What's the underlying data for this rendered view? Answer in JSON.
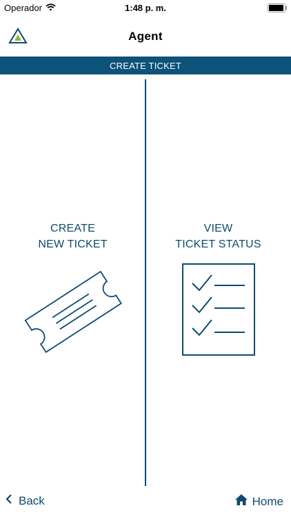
{
  "status_bar": {
    "carrier": "Operador",
    "time": "1:48 p. m.",
    "battery_level": 0.95,
    "icons": [
      "wifi-icon",
      "battery-icon"
    ]
  },
  "nav": {
    "title": "Agent",
    "logo_icon": "triangle-logo-icon"
  },
  "banner": {
    "text": "CREATE TICKET"
  },
  "options": {
    "create": {
      "line1": "CREATE",
      "line2": "NEW TICKET",
      "icon": "ticket-icon"
    },
    "view": {
      "line1": "VIEW",
      "line2": "TICKET STATUS",
      "icon": "checklist-icon"
    }
  },
  "bottom_bar": {
    "back_label": "Back",
    "home_label": "Home",
    "icons": [
      "chevron-left-icon",
      "home-icon"
    ]
  },
  "colors": {
    "primary": "#0d4a6e",
    "banner_bg": "#0d5278",
    "logo_accent": "#8cb83c"
  }
}
